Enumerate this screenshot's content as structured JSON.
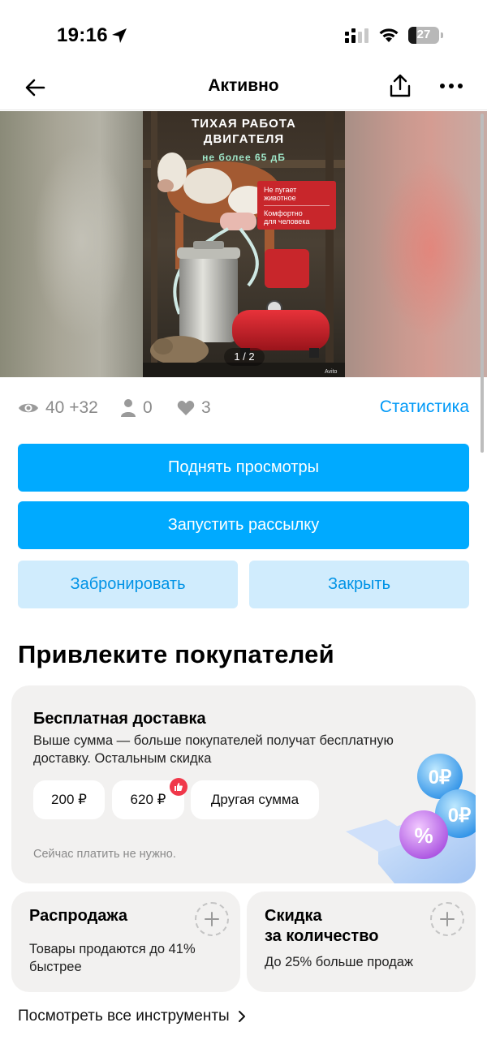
{
  "status_bar": {
    "time": "19:16",
    "battery": "27",
    "battery_level": 0.27
  },
  "nav": {
    "title": "Активно"
  },
  "gallery": {
    "headline_line1": "ТИХАЯ РАБОТА",
    "headline_line2": "ДВИГАТЕЛЯ",
    "subline": "не более 65 дБ",
    "badge_line1": "Не пугает",
    "badge_line2": "животное",
    "badge_line3": "Комфортно",
    "badge_line4": "для человека",
    "page_indicator": "1 / 2",
    "watermark": "Avito"
  },
  "stats": {
    "views": "40 +32",
    "contacts": "0",
    "favorites": "3",
    "link": "Статистика"
  },
  "actions": {
    "boost": "Поднять просмотры",
    "mailing": "Запустить рассылку",
    "reserve": "Забронировать",
    "close": "Закрыть"
  },
  "promo": {
    "section_title": "Привлеките покупателей",
    "delivery": {
      "title": "Бесплатная доставка",
      "description": "Выше сумма — больше покупателей получат бесплатную доставку. Остальным скидка",
      "chips": [
        "200 ₽",
        "620 ₽",
        "Другая сумма"
      ],
      "note": "Сейчас платить не нужно."
    },
    "sale": {
      "title": "Распродажа",
      "description": "Товары продаются до 41% быстрее"
    },
    "quantity": {
      "title_line1": "Скидка",
      "title_line2": "за количество",
      "description": "До 25% больше продаж"
    },
    "all_tools": "Посмотреть все инструменты"
  },
  "colors": {
    "primary": "#00aaff",
    "secondary_bg": "#d0ecfd",
    "secondary_text": "#0093e6",
    "link": "#0099f7",
    "card_bg": "#f2f1f0",
    "badge_red": "#f0384a"
  },
  "icons": {
    "location": "location-arrow-icon",
    "signal": "cellular-signal-icon",
    "wifi": "wifi-icon",
    "back": "arrow-left-icon",
    "share": "share-icon",
    "more": "more-dots-icon",
    "views": "eye-icon",
    "contacts": "person-icon",
    "favorites": "heart-icon",
    "chip_badge": "thumbs-up-icon",
    "plus": "plus-icon",
    "chevron": "chevron-right-icon"
  }
}
